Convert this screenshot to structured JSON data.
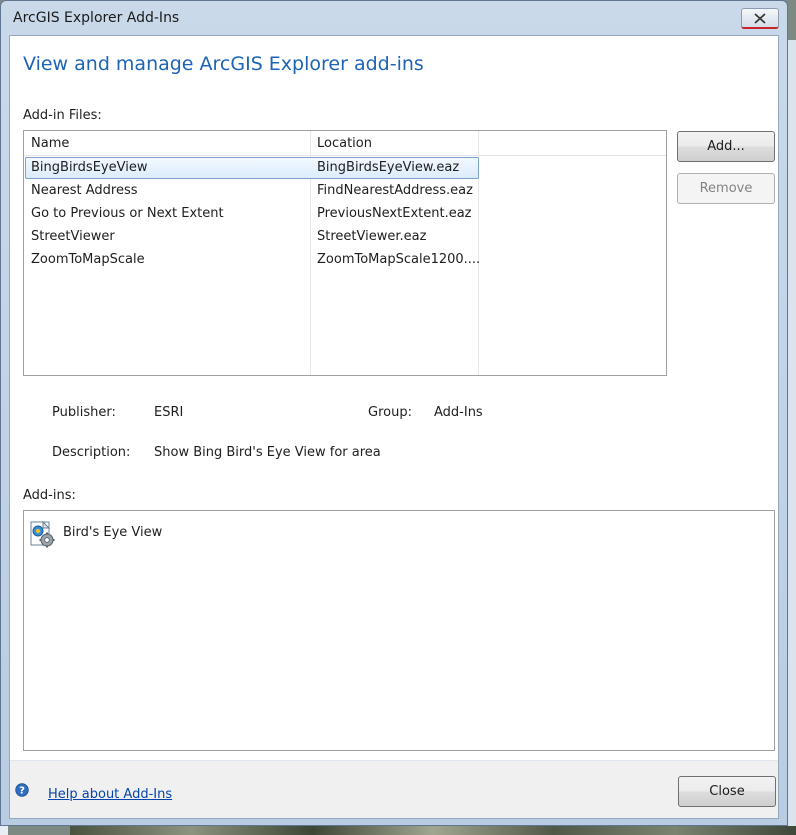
{
  "window": {
    "title": "ArcGIS Explorer Add-Ins"
  },
  "heading": "View and manage ArcGIS Explorer add-ins",
  "addin_files": {
    "label": "Add-in Files:",
    "columns": [
      "Name",
      "Location"
    ],
    "rows": [
      {
        "name": "BingBirdsEyeView",
        "location": "BingBirdsEyeView.eaz",
        "selected": true
      },
      {
        "name": "Nearest Address",
        "location": "FindNearestAddress.eaz"
      },
      {
        "name": "Go to Previous or Next Extent",
        "location": "PreviousNextExtent.eaz"
      },
      {
        "name": "StreetViewer",
        "location": "StreetViewer.eaz"
      },
      {
        "name": "ZoomToMapScale",
        "location": "ZoomToMapScale1200...."
      }
    ]
  },
  "buttons": {
    "add": "Add...",
    "remove": "Remove",
    "close": "Close"
  },
  "details": {
    "publisher_label": "Publisher:",
    "publisher_value": "ESRI",
    "group_label": "Group:",
    "group_value": "Add-Ins",
    "description_label": "Description:",
    "description_value": "Show Bing Bird's Eye View for area"
  },
  "addins": {
    "label": "Add-ins:",
    "items": [
      {
        "name": "Bird's Eye View",
        "icon": "addin-gear-icon"
      }
    ]
  },
  "footer": {
    "help_link": "Help about Add-Ins",
    "help_icon": "help-icon"
  },
  "colors": {
    "accent": "#1e64b4",
    "link": "#0645ad",
    "close_red": "#c8262b"
  }
}
